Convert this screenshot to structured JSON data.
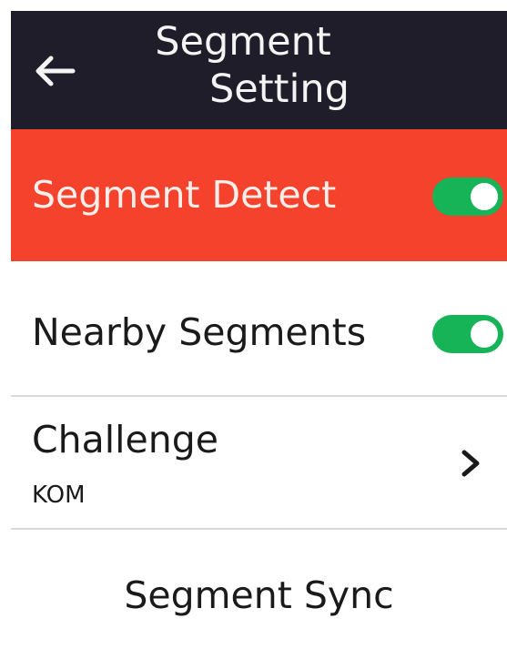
{
  "header": {
    "title_line1": "Segment",
    "title_line2": "Setting"
  },
  "settings": {
    "segment_detect": {
      "label": "Segment Detect",
      "enabled": true
    },
    "nearby_segments": {
      "label": "Nearby Segments",
      "enabled": true
    },
    "challenge": {
      "label": "Challenge",
      "value": "KOM"
    },
    "segment_sync": {
      "label": "Segment Sync"
    }
  },
  "colors": {
    "header_bg": "#1e1d29",
    "highlight_bg": "#f4422c",
    "toggle_on": "#17b357"
  },
  "icons": {
    "back": "arrow-left-icon",
    "challenge": "chevron-right-icon"
  }
}
